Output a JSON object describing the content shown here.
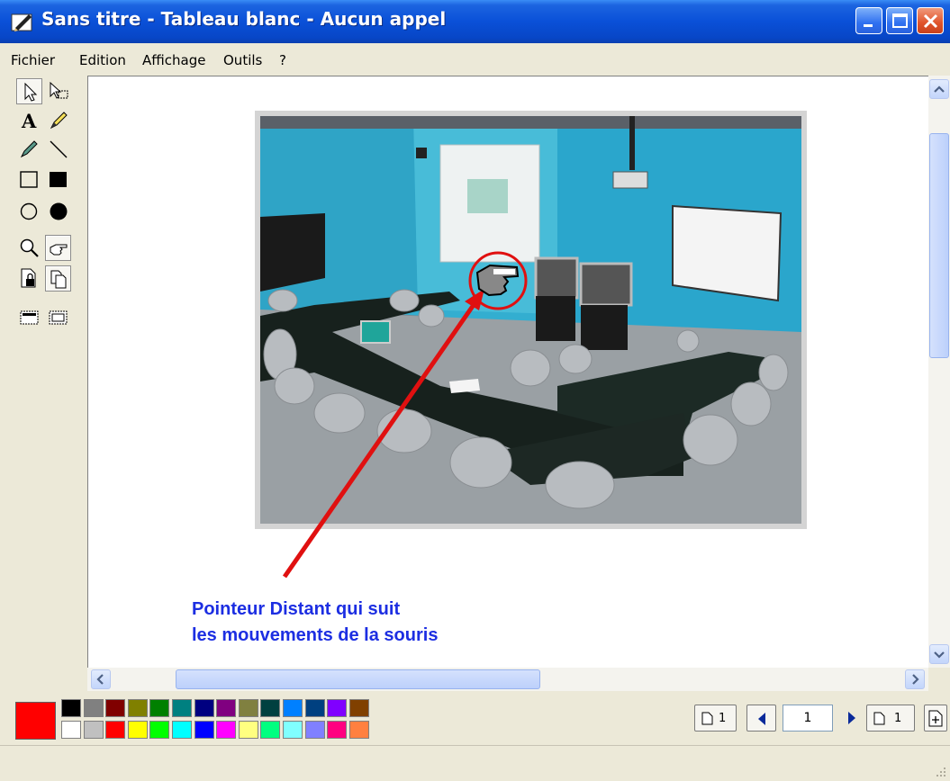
{
  "window": {
    "title": "Sans titre - Tableau blanc - Aucun appel"
  },
  "menu": [
    "Fichier",
    "Edition",
    "Affichage",
    "Outils",
    "?"
  ],
  "canvas": {
    "annotation_line1": "Pointeur Distant qui suit",
    "annotation_line2": "les mouvements de la souris"
  },
  "palette": {
    "current_color": "#ff0000",
    "top_row": [
      "#000000",
      "#808080",
      "#800000",
      "#808000",
      "#008000",
      "#008080",
      "#000080",
      "#800080",
      "#808040",
      "#004040",
      "#0080ff",
      "#004080",
      "#8000ff",
      "#804000"
    ],
    "bottom_row": [
      "#ffffff",
      "#c0c0c0",
      "#ff0000",
      "#ffff00",
      "#00ff00",
      "#00ffff",
      "#0000ff",
      "#ff00ff",
      "#ffff80",
      "#00ff80",
      "#80ffff",
      "#8080ff",
      "#ff0080",
      "#ff8040"
    ]
  },
  "pages": {
    "first_page_label": "1",
    "current_page_value": "1",
    "last_page_label": "1"
  },
  "colors": {
    "titlebar": "#0a50d8",
    "annotation_text": "#1c2ee2",
    "arrow": "#e01010"
  }
}
